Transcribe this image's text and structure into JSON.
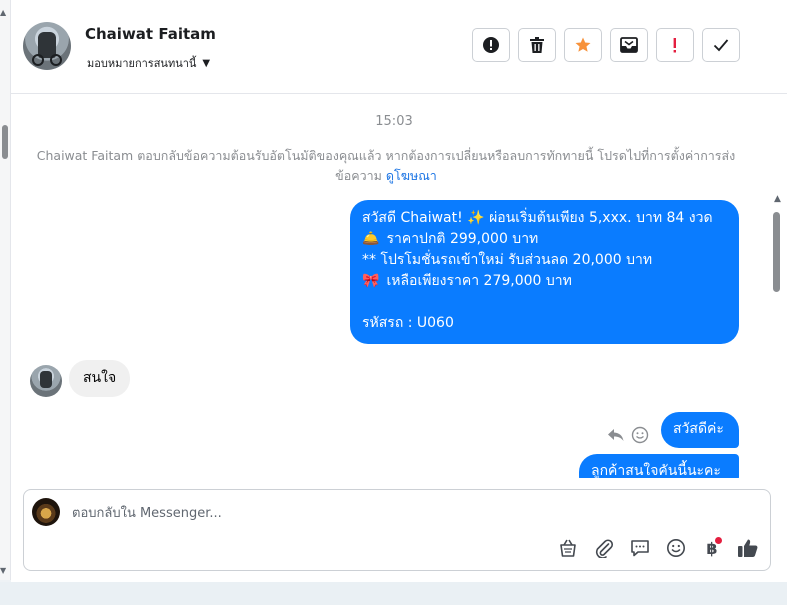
{
  "contact": {
    "name": "Chaiwat Faitam",
    "assign_label": "มอบหมายการสนทนานี้"
  },
  "actions": [
    {
      "name": "spam-button",
      "icon": "exclamation-circle-icon",
      "color": "#1c1e21"
    },
    {
      "name": "delete-button",
      "icon": "trash-icon",
      "color": "#1c1e21"
    },
    {
      "name": "star-button",
      "icon": "star-icon",
      "color": "#f7923b"
    },
    {
      "name": "archive-button",
      "icon": "inbox-icon",
      "color": "#1c1e21"
    },
    {
      "name": "priority-button",
      "icon": "exclamation-icon",
      "color": "#e41e3f"
    },
    {
      "name": "done-button",
      "icon": "check-icon",
      "color": "#1c1e21"
    }
  ],
  "conversation": {
    "timestamp": "15:03",
    "system_message": "Chaiwat Faitam ตอบกลับข้อความต้อนรับอัตโนมัติของคุณแล้ว หากต้องการเปลี่ยนหรือลบการทักทายนี้ โปรดไปที่การตั้งค่าการส่งข้อความ",
    "system_link": "ดูโฆษณา",
    "outgoing_main": {
      "line1": "สวัสดี Chaiwat! ✨  ผ่อนเริ่มต้นเพียง 5,xxx. บาท 84 งวด",
      "line2_emoji": "🛎️",
      "line2": " ราคาปกติ 299,000 บาท",
      "line3": "** โปรโมชั่นรถเข้าใหม่ รับส่วนลด 20,000 บาท",
      "line4_emoji": "🎀",
      "line4": " เหลือเพียงราคา 279,000 บาท",
      "line5": " รหัสรถ : U060"
    },
    "incoming": "สนใจ",
    "outgoing_hi": "สวัสดีค่ะ",
    "outgoing_cut": "ลูกค้าสนใจคันนี้นะคะ"
  },
  "composer": {
    "placeholder": "ตอบกลับใน Messenger..."
  },
  "colors": {
    "accent": "#0a7cff",
    "star": "#f7923b",
    "alert": "#e41e3f"
  }
}
